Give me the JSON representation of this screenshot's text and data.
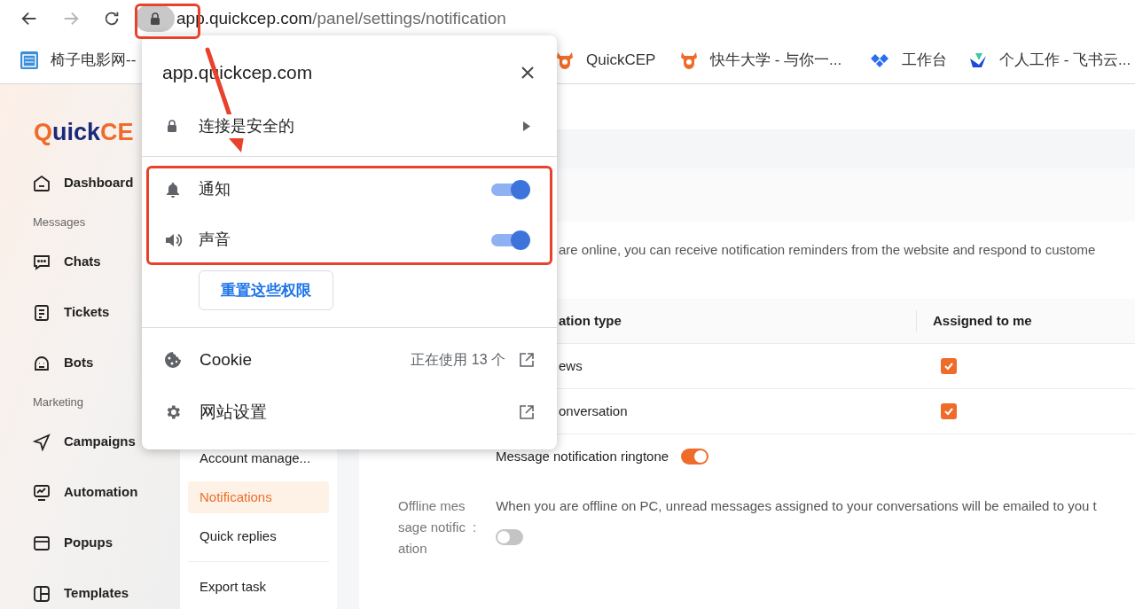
{
  "browser": {
    "url_host": "app.quickcep.com",
    "url_path": "/panel/settings/notification"
  },
  "bookmarks": [
    {
      "kind": "window",
      "label": "椅子电影网--"
    },
    {
      "kind": "cow",
      "label": "QuickCEP"
    },
    {
      "kind": "cow",
      "label": "快牛大学 - 与你一..."
    },
    {
      "kind": "diamond",
      "label": "工作台"
    },
    {
      "kind": "wing",
      "label": "个人工作 - 飞书云..."
    }
  ],
  "logo": {
    "first": "Q",
    "middle": "uick",
    "last": "CE"
  },
  "sidebar": {
    "items": [
      {
        "kind": "link",
        "label": "Dashboard"
      },
      {
        "kind": "heading",
        "label": "Messages"
      },
      {
        "kind": "link",
        "label": "Chats"
      },
      {
        "kind": "link",
        "label": "Tickets"
      },
      {
        "kind": "link",
        "label": "Bots"
      },
      {
        "kind": "heading",
        "label": "Marketing"
      },
      {
        "kind": "link",
        "label": "Campaigns"
      },
      {
        "kind": "link",
        "label": "Automation"
      },
      {
        "kind": "link",
        "label": "Popups"
      },
      {
        "kind": "link",
        "label": "Templates"
      }
    ]
  },
  "settings_menu": {
    "items": [
      {
        "label": "Account manage...",
        "selected": false
      },
      {
        "label": "Notifications",
        "selected": true
      },
      {
        "label": "Quick replies",
        "selected": false
      },
      {
        "label": "Export task",
        "selected": false
      }
    ]
  },
  "online_description": "are online, you can receive notification reminders from the website and respond to custome",
  "table": {
    "columns": [
      "ation type",
      "Assigned to me"
    ],
    "rows": [
      {
        "type": "ews",
        "checked": true
      },
      {
        "type": "onversation",
        "checked": true
      }
    ]
  },
  "ringtone": {
    "label": "Message notification ringtone",
    "on": true
  },
  "offline": {
    "label": "Offline message notification",
    "separator": ":",
    "description": "When you are offline on PC, unread messages assigned to your conversations will be emailed to you t",
    "on": false
  },
  "site_popup": {
    "title": "app.quickcep.com",
    "connection": "连接是安全的",
    "permissions": [
      {
        "label": "通知",
        "on": true
      },
      {
        "label": "声音",
        "on": true
      }
    ],
    "reset_button": "重置这些权限",
    "cookie": {
      "label": "Cookie",
      "status": "正在使用 13 个"
    },
    "site_settings": "网站设置"
  }
}
